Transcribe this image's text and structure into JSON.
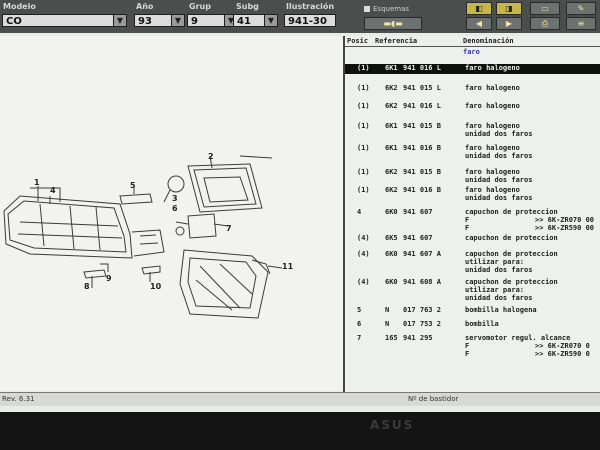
{
  "toolbar": {
    "modelo_label": "Modelo",
    "modelo_value": "CO",
    "ano_label": "Año",
    "ano_value": "93",
    "grup_label": "Grup",
    "grup_value": "9",
    "subg_label": "Subg",
    "subg_value": "41",
    "ilustracion_label": "Ilustración",
    "ilustracion_value": "941-30",
    "esquemas_label": "Esquemas"
  },
  "diagram": {
    "callouts": [
      "1",
      "2",
      "3",
      "4",
      "5",
      "6",
      "7",
      "8",
      "9",
      "10",
      "11"
    ]
  },
  "parts": {
    "headers": {
      "pos": "Posic",
      "ref": "Referencia",
      "den": "Denominación"
    },
    "group_title": "faro",
    "rows": [
      {
        "pos": "(1)",
        "a": "6K1",
        "b": "941 016 L",
        "desc": [
          "faro halogeno"
        ],
        "ext": [],
        "selected": true
      },
      {
        "pos": "(1)",
        "a": "6K2",
        "b": "941 015 L",
        "desc": [
          "faro halogeno"
        ],
        "ext": []
      },
      {
        "pos": "(1)",
        "a": "6K2",
        "b": "941 016 L",
        "desc": [
          "faro halogeno"
        ],
        "ext": []
      },
      {
        "pos": "(1)",
        "a": "6K1",
        "b": "941 015 B",
        "desc": [
          "faro halogeno",
          "unidad dos faros"
        ],
        "ext": []
      },
      {
        "pos": "(1)",
        "a": "6K1",
        "b": "941 016 B",
        "desc": [
          "faro halogeno",
          "unidad dos faros"
        ],
        "ext": []
      },
      {
        "pos": "(1)",
        "a": "6K2",
        "b": "941 015 B",
        "desc": [
          "faro halogeno",
          "unidad dos faros"
        ],
        "ext": []
      },
      {
        "pos": "(1)",
        "a": "6K2",
        "b": "941 016 B",
        "desc": [
          "faro halogeno",
          "unidad dos faros"
        ],
        "ext": []
      },
      {
        "pos": "4",
        "a": "6K0",
        "b": "941 607",
        "desc": [
          "capuchon de proteccion",
          "F",
          "F"
        ],
        "ext": [
          "",
          ">> 6K-ZR070 00",
          ">> 6K-ZR590 00"
        ]
      },
      {
        "pos": "(4)",
        "a": "6K5",
        "b": "941 607",
        "desc": [
          "capuchon de proteccion"
        ],
        "ext": []
      },
      {
        "pos": "(4)",
        "a": "6K0",
        "b": "941 607 A",
        "desc": [
          "capuchon de proteccion",
          "utilizar para:",
          "unidad dos faros"
        ],
        "ext": []
      },
      {
        "pos": "(4)",
        "a": "6K0",
        "b": "941 608 A",
        "desc": [
          "capuchon de proteccion",
          "utilizar para:",
          "unidad dos faros"
        ],
        "ext": []
      },
      {
        "pos": "5",
        "a": "N",
        "b": "017 763 2",
        "desc": [
          "bombilla halogena"
        ],
        "ext": []
      },
      {
        "pos": "6",
        "a": "N",
        "b": "017 753 2",
        "desc": [
          "bombilla"
        ],
        "ext": []
      },
      {
        "pos": "7",
        "a": "165",
        "b": "941 295",
        "desc": [
          "servomotor regul. alcance",
          "F",
          "F"
        ],
        "ext": [
          "",
          ">> 6K-ZR070 0",
          ">> 6K-ZR590 0"
        ]
      }
    ]
  },
  "status": {
    "version": "Rev. 6.31",
    "bastidor": "Nº de bastidor"
  },
  "brand": "ASUS"
}
